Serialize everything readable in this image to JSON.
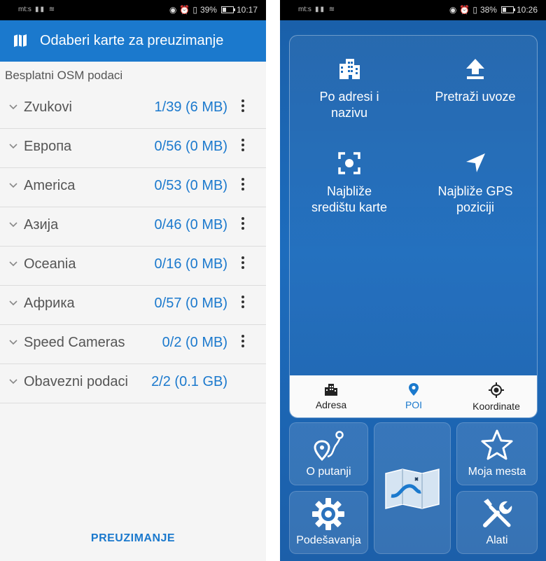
{
  "left": {
    "status": {
      "carrier": "mt:s",
      "battery": "39%",
      "time": "10:17",
      "battery_level": 0.39
    },
    "appbar": {
      "title": "Odaberi karte za preuzimanje",
      "icon": "map-icon"
    },
    "section": "Besplatni OSM podaci",
    "rows": [
      {
        "name": "Zvukovi",
        "count": "1/39 (6 MB)"
      },
      {
        "name": "Европа",
        "count": "0/56 (0 MB)"
      },
      {
        "name": "America",
        "count": "0/53 (0 MB)"
      },
      {
        "name": "Азија",
        "count": "0/46 (0 MB)"
      },
      {
        "name": "Oceania",
        "count": "0/16 (0 MB)"
      },
      {
        "name": "Африка",
        "count": "0/57 (0 MB)"
      },
      {
        "name": "Speed Cameras",
        "count": "0/2 (0 MB)"
      },
      {
        "name": "Obavezni podaci",
        "count": "2/2 (0.1 GB)"
      }
    ],
    "download_label": "PREUZIMANJE"
  },
  "right": {
    "status": {
      "carrier": "mt:s",
      "battery": "38%",
      "time": "10:26",
      "battery_level": 0.38
    },
    "options": [
      {
        "label1": "Po adresi i",
        "label2": "nazivu",
        "icon": "building-icon"
      },
      {
        "label1": "Pretraži uvoze",
        "label2": "",
        "icon": "upload-icon"
      },
      {
        "label1": "Najbliže",
        "label2": "središtu karte",
        "icon": "focus-center-icon"
      },
      {
        "label1": "Najbliže GPS",
        "label2": "poziciji",
        "icon": "navigation-arrow-icon"
      }
    ],
    "tabs": [
      {
        "label": "Adresa",
        "icon": "building-icon"
      },
      {
        "label": "POI",
        "icon": "map-pin-icon"
      },
      {
        "label": "Koordinate",
        "icon": "crosshair-icon"
      }
    ],
    "tiles": {
      "route": "O putanji",
      "favorites": "Moja mesta",
      "settings": "Podešavanja",
      "tools": "Alati"
    }
  },
  "colors": {
    "accent": "#1b79cd",
    "panel_blue": "#1d6cbd"
  }
}
